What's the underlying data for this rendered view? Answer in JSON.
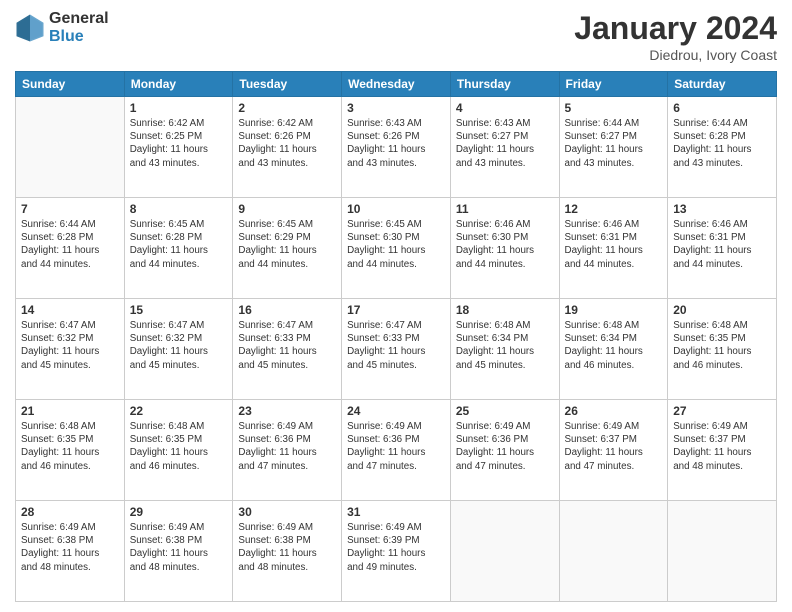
{
  "logo": {
    "general": "General",
    "blue": "Blue"
  },
  "title": "January 2024",
  "subtitle": "Diedrou, Ivory Coast",
  "weekdays": [
    "Sunday",
    "Monday",
    "Tuesday",
    "Wednesday",
    "Thursday",
    "Friday",
    "Saturday"
  ],
  "weeks": [
    [
      {
        "day": "",
        "text": ""
      },
      {
        "day": "1",
        "text": "Sunrise: 6:42 AM\nSunset: 6:25 PM\nDaylight: 11 hours\nand 43 minutes."
      },
      {
        "day": "2",
        "text": "Sunrise: 6:42 AM\nSunset: 6:26 PM\nDaylight: 11 hours\nand 43 minutes."
      },
      {
        "day": "3",
        "text": "Sunrise: 6:43 AM\nSunset: 6:26 PM\nDaylight: 11 hours\nand 43 minutes."
      },
      {
        "day": "4",
        "text": "Sunrise: 6:43 AM\nSunset: 6:27 PM\nDaylight: 11 hours\nand 43 minutes."
      },
      {
        "day": "5",
        "text": "Sunrise: 6:44 AM\nSunset: 6:27 PM\nDaylight: 11 hours\nand 43 minutes."
      },
      {
        "day": "6",
        "text": "Sunrise: 6:44 AM\nSunset: 6:28 PM\nDaylight: 11 hours\nand 43 minutes."
      }
    ],
    [
      {
        "day": "7",
        "text": "Sunrise: 6:44 AM\nSunset: 6:28 PM\nDaylight: 11 hours\nand 44 minutes."
      },
      {
        "day": "8",
        "text": "Sunrise: 6:45 AM\nSunset: 6:28 PM\nDaylight: 11 hours\nand 44 minutes."
      },
      {
        "day": "9",
        "text": "Sunrise: 6:45 AM\nSunset: 6:29 PM\nDaylight: 11 hours\nand 44 minutes."
      },
      {
        "day": "10",
        "text": "Sunrise: 6:45 AM\nSunset: 6:30 PM\nDaylight: 11 hours\nand 44 minutes."
      },
      {
        "day": "11",
        "text": "Sunrise: 6:46 AM\nSunset: 6:30 PM\nDaylight: 11 hours\nand 44 minutes."
      },
      {
        "day": "12",
        "text": "Sunrise: 6:46 AM\nSunset: 6:31 PM\nDaylight: 11 hours\nand 44 minutes."
      },
      {
        "day": "13",
        "text": "Sunrise: 6:46 AM\nSunset: 6:31 PM\nDaylight: 11 hours\nand 44 minutes."
      }
    ],
    [
      {
        "day": "14",
        "text": "Sunrise: 6:47 AM\nSunset: 6:32 PM\nDaylight: 11 hours\nand 45 minutes."
      },
      {
        "day": "15",
        "text": "Sunrise: 6:47 AM\nSunset: 6:32 PM\nDaylight: 11 hours\nand 45 minutes."
      },
      {
        "day": "16",
        "text": "Sunrise: 6:47 AM\nSunset: 6:33 PM\nDaylight: 11 hours\nand 45 minutes."
      },
      {
        "day": "17",
        "text": "Sunrise: 6:47 AM\nSunset: 6:33 PM\nDaylight: 11 hours\nand 45 minutes."
      },
      {
        "day": "18",
        "text": "Sunrise: 6:48 AM\nSunset: 6:34 PM\nDaylight: 11 hours\nand 45 minutes."
      },
      {
        "day": "19",
        "text": "Sunrise: 6:48 AM\nSunset: 6:34 PM\nDaylight: 11 hours\nand 46 minutes."
      },
      {
        "day": "20",
        "text": "Sunrise: 6:48 AM\nSunset: 6:35 PM\nDaylight: 11 hours\nand 46 minutes."
      }
    ],
    [
      {
        "day": "21",
        "text": "Sunrise: 6:48 AM\nSunset: 6:35 PM\nDaylight: 11 hours\nand 46 minutes."
      },
      {
        "day": "22",
        "text": "Sunrise: 6:48 AM\nSunset: 6:35 PM\nDaylight: 11 hours\nand 46 minutes."
      },
      {
        "day": "23",
        "text": "Sunrise: 6:49 AM\nSunset: 6:36 PM\nDaylight: 11 hours\nand 47 minutes."
      },
      {
        "day": "24",
        "text": "Sunrise: 6:49 AM\nSunset: 6:36 PM\nDaylight: 11 hours\nand 47 minutes."
      },
      {
        "day": "25",
        "text": "Sunrise: 6:49 AM\nSunset: 6:36 PM\nDaylight: 11 hours\nand 47 minutes."
      },
      {
        "day": "26",
        "text": "Sunrise: 6:49 AM\nSunset: 6:37 PM\nDaylight: 11 hours\nand 47 minutes."
      },
      {
        "day": "27",
        "text": "Sunrise: 6:49 AM\nSunset: 6:37 PM\nDaylight: 11 hours\nand 48 minutes."
      }
    ],
    [
      {
        "day": "28",
        "text": "Sunrise: 6:49 AM\nSunset: 6:38 PM\nDaylight: 11 hours\nand 48 minutes."
      },
      {
        "day": "29",
        "text": "Sunrise: 6:49 AM\nSunset: 6:38 PM\nDaylight: 11 hours\nand 48 minutes."
      },
      {
        "day": "30",
        "text": "Sunrise: 6:49 AM\nSunset: 6:38 PM\nDaylight: 11 hours\nand 48 minutes."
      },
      {
        "day": "31",
        "text": "Sunrise: 6:49 AM\nSunset: 6:39 PM\nDaylight: 11 hours\nand 49 minutes."
      },
      {
        "day": "",
        "text": ""
      },
      {
        "day": "",
        "text": ""
      },
      {
        "day": "",
        "text": ""
      }
    ]
  ]
}
